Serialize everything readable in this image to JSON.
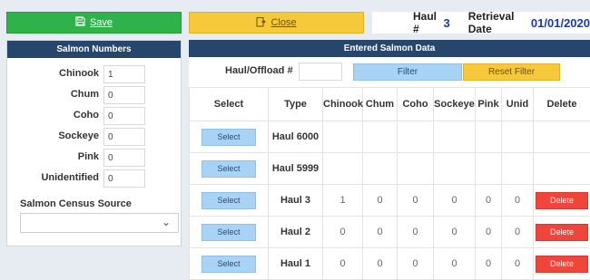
{
  "toolbar": {
    "save_label": "Save",
    "close_label": "Close"
  },
  "haul": {
    "label": "Haul #",
    "value": "3",
    "retrieval_label": "Retrieval Date",
    "retrieval_value": "01/01/2020"
  },
  "salmon_numbers": {
    "title": "Salmon Numbers",
    "fields": [
      {
        "label": "Chinook",
        "value": "1"
      },
      {
        "label": "Chum",
        "value": "0"
      },
      {
        "label": "Coho",
        "value": "0"
      },
      {
        "label": "Sockeye",
        "value": "0"
      },
      {
        "label": "Pink",
        "value": "0"
      },
      {
        "label": "Unidentified",
        "value": "0"
      }
    ],
    "census_label": "Salmon Census Source",
    "census_value": ""
  },
  "entered": {
    "title": "Entered Salmon Data",
    "haul_offload_label": "Haul/Offload #",
    "haul_offload_value": "",
    "filter_label": "Filter",
    "reset_label": "Reset Filter",
    "columns": [
      "Select",
      "Type",
      "Chinook",
      "Chum",
      "Coho",
      "Sockeye",
      "Pink",
      "Unid",
      "Delete"
    ],
    "rows": [
      {
        "select": "Select",
        "type": "Haul 6000",
        "chinook": "",
        "chum": "",
        "coho": "",
        "sockeye": "",
        "pink": "",
        "unid": "",
        "delete": ""
      },
      {
        "select": "Select",
        "type": "Haul 5999",
        "chinook": "",
        "chum": "",
        "coho": "",
        "sockeye": "",
        "pink": "",
        "unid": "",
        "delete": ""
      },
      {
        "select": "Select",
        "type": "Haul 3",
        "chinook": "1",
        "chum": "0",
        "coho": "0",
        "sockeye": "0",
        "pink": "0",
        "unid": "0",
        "delete": "Delete"
      },
      {
        "select": "Select",
        "type": "Haul 2",
        "chinook": "0",
        "chum": "0",
        "coho": "0",
        "sockeye": "0",
        "pink": "0",
        "unid": "0",
        "delete": "Delete"
      },
      {
        "select": "Select",
        "type": "Haul 1",
        "chinook": "0",
        "chum": "0",
        "coho": "0",
        "sockeye": "0",
        "pink": "0",
        "unid": "0",
        "delete": "Delete"
      }
    ]
  },
  "colors": {
    "save": "#2fb24b",
    "close": "#f6c93a",
    "header": "#27466b",
    "accent_value": "#1a37b8",
    "select_button": "#a9d3f5",
    "delete_button": "#f0453a"
  }
}
